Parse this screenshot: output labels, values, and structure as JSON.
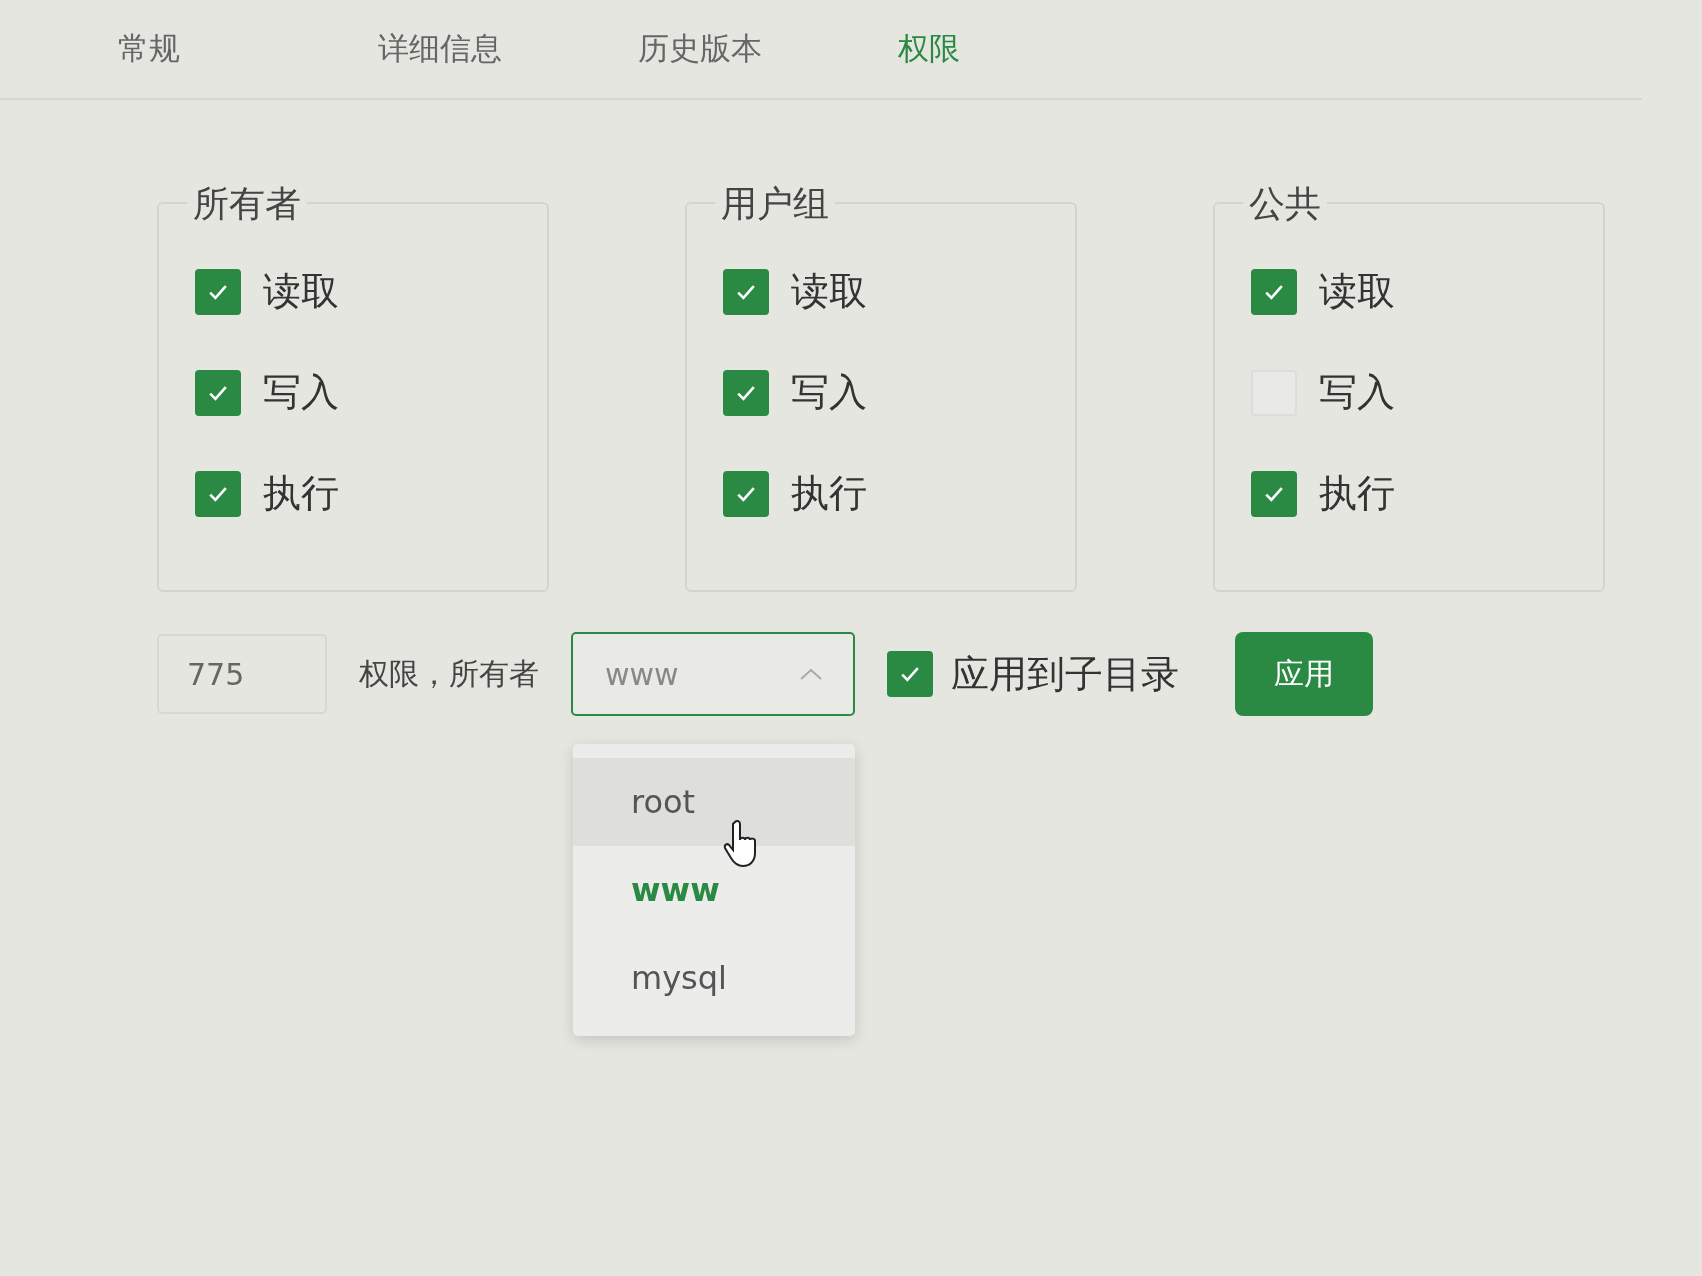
{
  "tabs": [
    {
      "label": "常规",
      "selected": false
    },
    {
      "label": "详细信息",
      "selected": false
    },
    {
      "label": "历史版本",
      "selected": false
    },
    {
      "label": "权限",
      "selected": true
    }
  ],
  "groups": [
    {
      "title": "所有者",
      "permissions": [
        {
          "label": "读取",
          "checked": true
        },
        {
          "label": "写入",
          "checked": true
        },
        {
          "label": "执行",
          "checked": true
        }
      ]
    },
    {
      "title": "用户组",
      "permissions": [
        {
          "label": "读取",
          "checked": true
        },
        {
          "label": "写入",
          "checked": true
        },
        {
          "label": "执行",
          "checked": true
        }
      ]
    },
    {
      "title": "公共",
      "permissions": [
        {
          "label": "读取",
          "checked": true
        },
        {
          "label": "写入",
          "checked": false
        },
        {
          "label": "执行",
          "checked": true
        }
      ]
    }
  ],
  "mode": {
    "value": "775"
  },
  "owner_label": "权限，所有者",
  "owner_select": {
    "value": "www",
    "expanded": true,
    "options": [
      {
        "label": "root",
        "selected": false,
        "hovered": true
      },
      {
        "label": "www",
        "selected": true,
        "hovered": false
      },
      {
        "label": "mysql",
        "selected": false,
        "hovered": false
      }
    ]
  },
  "recursive": {
    "label": "应用到子目录",
    "checked": true
  },
  "apply_button": "应用"
}
